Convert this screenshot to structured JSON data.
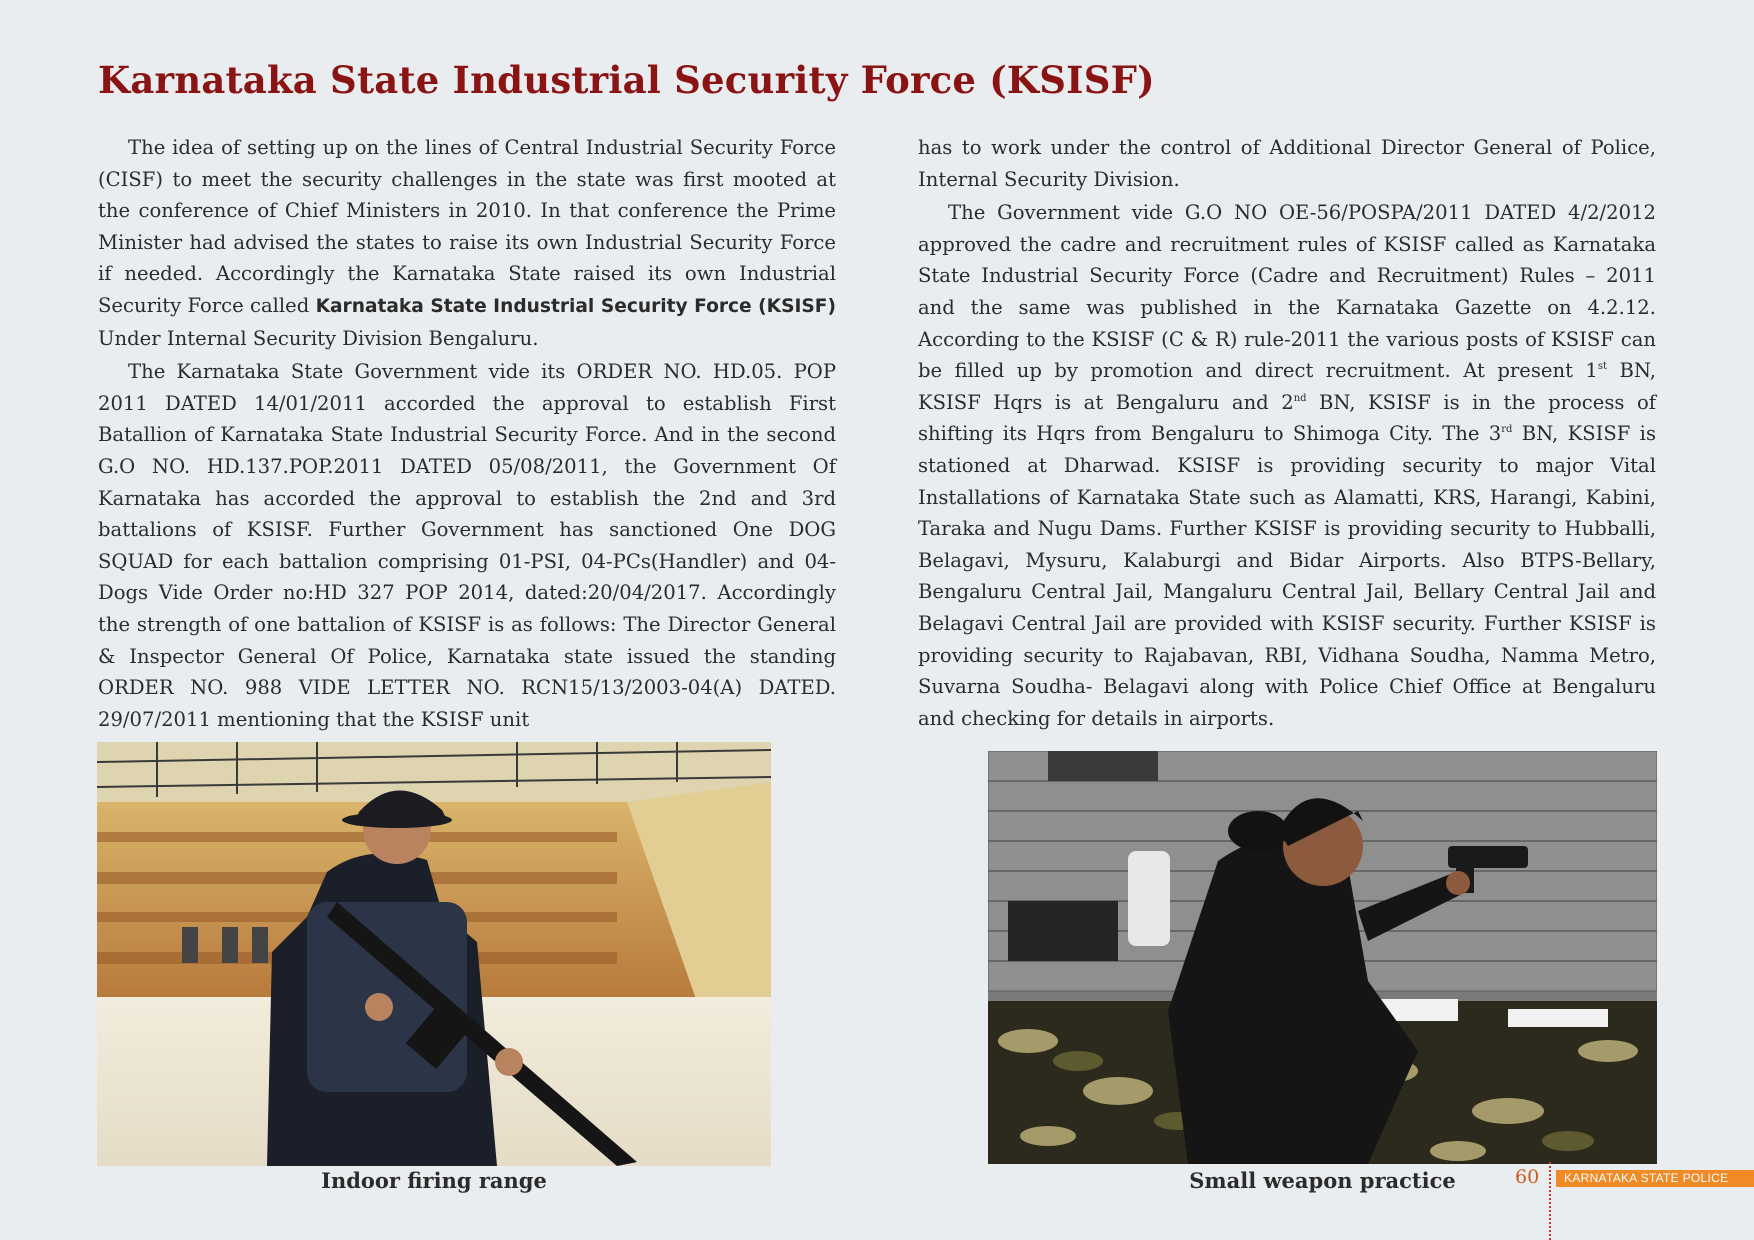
{
  "title": "Karnataka State Industrial Security Force (KSISF)",
  "left_column": {
    "p1_before": "The idea of setting up on the lines of Central Industrial Security Force (CISF) to meet the security challenges in the state was first mooted at the conference of Chief Ministers in 2010.  In that conference the Prime Minister had advised the states to raise its own Industrial Security Force if needed. Accordingly the Karnataka State raised its own Industrial Security Force called ",
    "p1_bold": "Karnataka State Industrial Security Force (KSISF)",
    "p1_after": " Under  Internal Security Division  Bengaluru.",
    "p2": "The Karnataka State Government vide its ORDER NO. HD.05. POP 2011 DATED 14/01/2011 accorded the approval to establish First Batallion of Karnataka State Industrial Security Force. And in the second G.O NO. HD.137.POP.2011 DATED 05/08/2011,   the Government Of Karnataka has accorded the approval to establish the 2nd and 3rd battalions of KSISF. Further Government has sanctioned One DOG SQUAD for each battalion comprising  01-PSI, 04-PCs(Handler) and 04-Dogs Vide Order no:HD 327 POP 2014, dated:20/04/2017. Accordingly the strength of one battalion of KSISF is as follows: The Director General & Inspector General Of Police, Karnataka state issued the standing ORDER NO. 988 VIDE LETTER NO. RCN15/13/2003-04(A) DATED. 29/07/2011 mentioning that the KSISF unit"
  },
  "right_column": {
    "p1": "has to work under the control of Additional Director General of Police, Internal Security Division.",
    "p2_a": "The Government vide G.O NO OE-56/POSPA/2011 DATED 4/2/2012 approved the cadre and recruitment rules of KSISF called as Karnataka State Industrial Security Force (Cadre and Recruitment) Rules – 2011 and the same was published in the Karnataka Gazette on 4.2.12. According to the KSISF (C & R) rule-2011 the various posts of KSISF can be filled up by promotion and direct recruitment. At present 1",
    "sup1": "st",
    "p2_b": " BN, KSISF Hqrs is at Bengaluru and 2",
    "sup2": "nd",
    "p2_c": " BN, KSISF is in the process of shifting its Hqrs from Bengaluru to Shimoga City.  The 3",
    "sup3": "rd",
    "p2_d": " BN, KSISF is stationed at Dharwad. KSISF is providing security to major Vital Installations of Karnataka State such as Alamatti, KRS, Harangi, Kabini, Taraka and Nugu Dams.  Further KSISF is providing security to Hubballi, Belagavi, Mysuru, Kalaburgi and Bidar Airports.   Also BTPS-Bellary, Bengaluru Central Jail, Mangaluru Central Jail, Bellary Central Jail and Belagavi Central Jail are provided with KSISF security.   Further KSISF is providing security to Rajabavan, RBI, Vidhana Soudha, Namma Metro, Suvarna Soudha- Belagavi along with Police Chief  Office at Bengaluru and checking for details in airports."
  },
  "photos": {
    "left_caption": "Indoor firing range",
    "right_caption": "Small weapon practice"
  },
  "footer": {
    "page_number": "60",
    "banner": "KARNATAKA STATE POLICE"
  }
}
